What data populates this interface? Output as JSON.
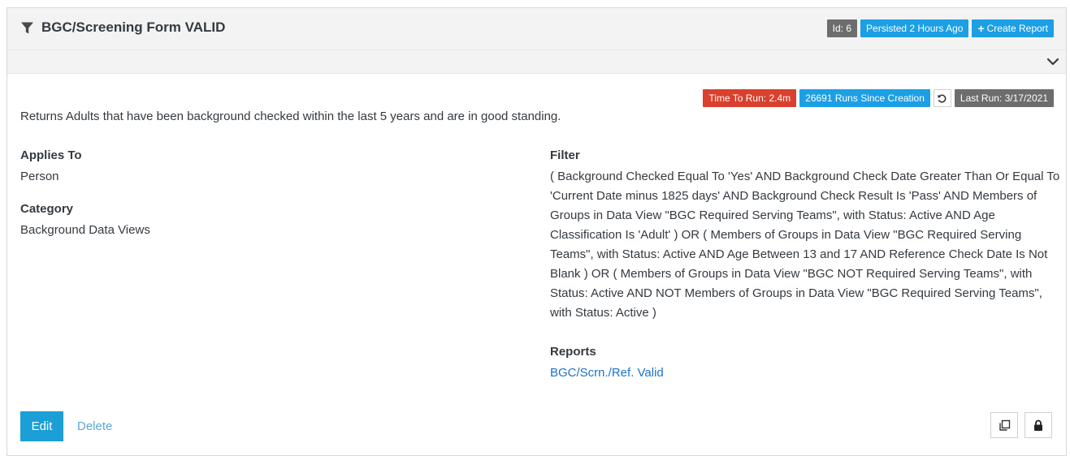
{
  "header": {
    "title": "BGC/Screening Form VALID",
    "id_label": "Id: 6",
    "persisted_label": "Persisted 2 Hours Ago",
    "create_report_label": "Create Report"
  },
  "stats": {
    "time_to_run": "Time To Run: 2.4m",
    "runs_since_creation": "26691 Runs Since Creation",
    "last_run": "Last Run: 3/17/2021"
  },
  "description": "Returns Adults that have been background checked within the last 5 years and are in good standing.",
  "details": {
    "applies_to_label": "Applies To",
    "applies_to_value": "Person",
    "category_label": "Category",
    "category_value": "Background Data Views",
    "filter_label": "Filter",
    "filter_value": "( Background Checked Equal To 'Yes' AND Background Check Date Greater Than Or Equal To 'Current Date minus 1825 days' AND Background Check Result Is 'Pass' AND Members of Groups in Data View \"BGC Required Serving Teams\", with Status: Active AND Age Classification Is 'Adult' ) OR ( Members of Groups in Data View \"BGC Required Serving Teams\", with Status: Active AND Age Between 13 and 17 AND Reference Check Date Is Not Blank ) OR ( Members of Groups in Data View \"BGC NOT Required Serving Teams\", with Status: Active AND NOT Members of Groups in Data View \"BGC Required Serving Teams\", with Status: Active )",
    "reports_label": "Reports",
    "report_link": "BGC/Scrn./Ref. Valid"
  },
  "actions": {
    "edit_label": "Edit",
    "delete_label": "Delete"
  },
  "colors": {
    "label_gray": "#6d6d6d",
    "label_blue": "#1c9fe5",
    "label_red": "#d9402e",
    "primary_button": "#1c9fd6",
    "link": "#1a73c8"
  },
  "icons": {
    "title_icon": "filter-icon",
    "create_icon": "plus-icon",
    "drawer_icon": "chevron-down-icon",
    "refresh_icon": "refresh-icon",
    "copy_icon": "copy-icon",
    "lock_icon": "lock-icon"
  }
}
